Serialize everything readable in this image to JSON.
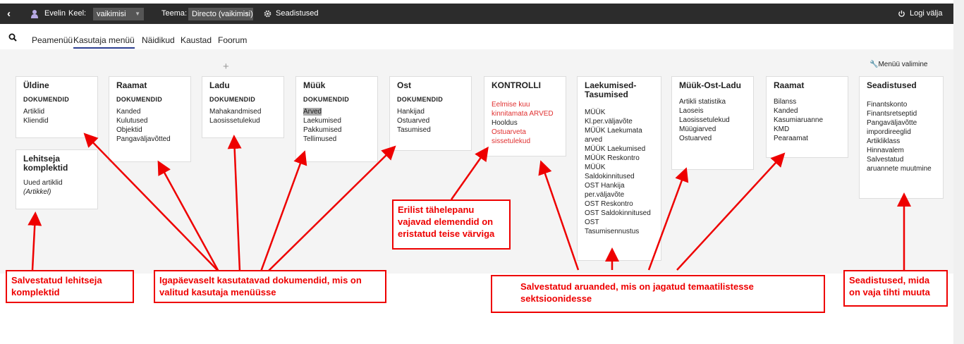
{
  "topbar": {
    "user": "Evelin",
    "lang_label": "Keel:",
    "lang_value": "vaikimisi",
    "theme_label": "Teema:",
    "theme_value": "Directo (vaikimisi)",
    "settings": "Seadistused",
    "logout": "Logi välja"
  },
  "tabs": [
    "Peamenüü",
    "Kasutaja menüü",
    "Näidikud",
    "Kaustad",
    "Foorum"
  ],
  "menu_choose": "Menüü valimine",
  "boxes": {
    "yldine": {
      "title": "Üldine",
      "sub": "DOKUMENDID",
      "items": [
        "Artiklid",
        "Kliendid"
      ]
    },
    "lehitseja": {
      "title": "Lehitseja komplektid",
      "items": [
        "Uued artiklid",
        "(Artikkel)"
      ]
    },
    "raamat1": {
      "title": "Raamat",
      "sub": "DOKUMENDID",
      "items": [
        "Kanded",
        "Kulutused",
        "Objektid",
        "Pangaväljavõtted"
      ]
    },
    "ladu": {
      "title": "Ladu",
      "sub": "DOKUMENDID",
      "items": [
        "Mahakandmised",
        "Laosissetulekud"
      ]
    },
    "myyk": {
      "title": "Müük",
      "sub": "DOKUMENDID",
      "items": [
        "Arved",
        "Laekumised",
        "Pakkumised",
        "Tellimused"
      ]
    },
    "ost": {
      "title": "Ost",
      "sub": "DOKUMENDID",
      "items": [
        "Hankijad",
        "Ostuarved",
        "Tasumised"
      ]
    },
    "kontrolli": {
      "title": "KONTROLLI",
      "items": [
        "Eelmise kuu kinnitamata ARVED",
        "Hooldus",
        "Ostuarveta sissetulekud"
      ]
    },
    "laekumised": {
      "title": "Laekumised-Tasumised",
      "items": [
        "MÜÜK Kl.per.väljavõte",
        "MÜÜK Laekumata arved",
        "MÜÜK Laekumised",
        "MÜÜK Reskontro",
        "MÜÜK Saldokinnitused",
        "OST Hankija per.väljavõte",
        "OST Reskontro",
        "OST Saldokinnitused",
        "OST Tasumisennustus"
      ]
    },
    "myykostladu": {
      "title": "Müük-Ost-Ladu",
      "items": [
        "Artikli statistika",
        "Laoseis",
        "Laosissetulekud",
        "Müügiarved",
        "Ostuarved"
      ]
    },
    "raamat2": {
      "title": "Raamat",
      "items": [
        "Bilanss",
        "Kanded",
        "Kasumiaruanne",
        "KMD",
        "Pearaamat"
      ]
    },
    "seadistused": {
      "title": "Seadistused",
      "items": [
        "Finantskonto",
        "Finantsretseptid",
        "Pangaväljavõtte impordireeglid",
        "Artikliklass",
        "Hinnavalem",
        "Salvestatud aruannete muutmine"
      ]
    }
  },
  "annotations": {
    "a1": "Salvestatud lehitseja komplektid",
    "a2": "Igapäevaselt kasutatavad dokumendid, mis on valitud kasutaja menüüsse",
    "a3": "Erilist tähelepanu vajavad elemendid on eristatud teise värviga",
    "a4": "Salvestatud aruanded, mis on jagatud temaatilistesse sektsioonidesse",
    "a5": "Seadistused, mida on vaja tihti muuta"
  },
  "colors": {
    "topbar": "#2c2c2c",
    "accent_red": "#e00000",
    "tab_underline": "#2c3e90"
  }
}
